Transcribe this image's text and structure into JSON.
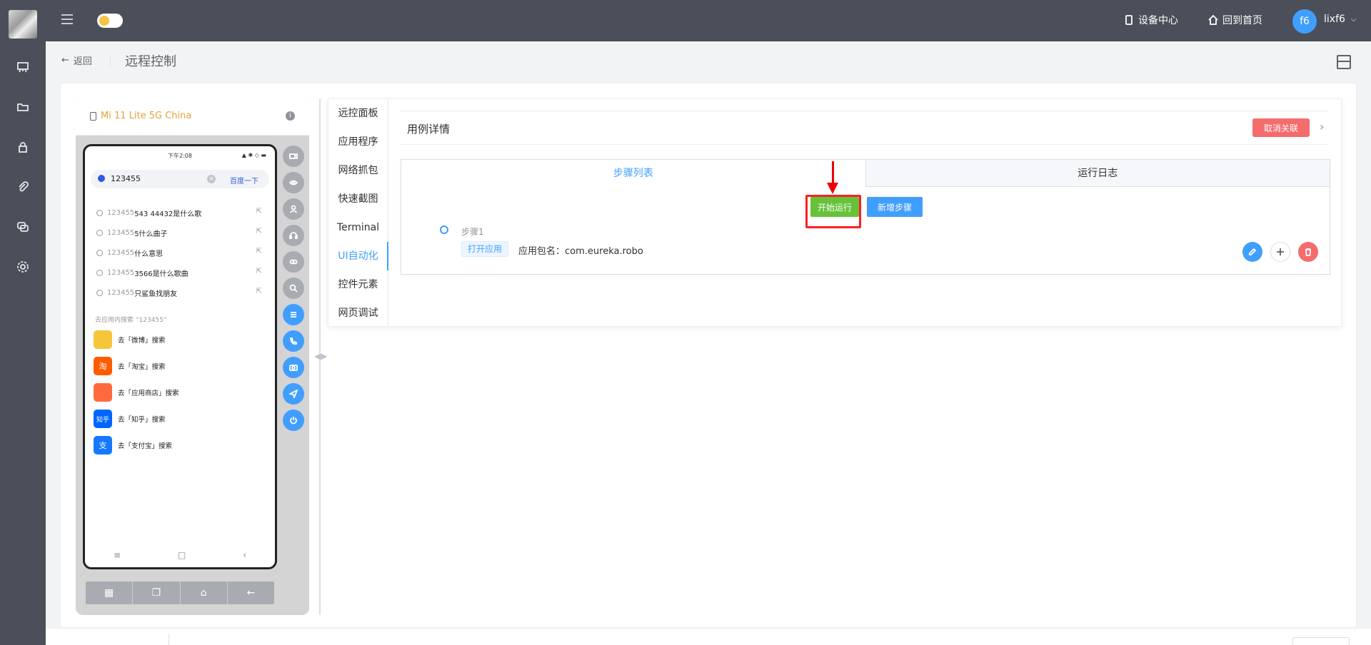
{
  "topbar": {
    "device_center": "设备中心",
    "home": "回到首页",
    "avatar_initials": "f6",
    "username": "lixf6"
  },
  "header": {
    "back": "返回",
    "title": "远程控制"
  },
  "device": {
    "name": "Mi 11 Lite 5G China",
    "status_time": "下午2:08",
    "search_value": "123455",
    "search_button": "百度一下",
    "suggestions": [
      {
        "prefix": "123455",
        "rest": "543 44432是什么歌"
      },
      {
        "prefix": "123455",
        "rest": "5什么曲子"
      },
      {
        "prefix": "123455",
        "rest": "什么意思"
      },
      {
        "prefix": "123455",
        "rest": "3566是什么歌曲"
      },
      {
        "prefix": "123455",
        "rest": "只鲨鱼找朋友"
      }
    ],
    "in_app_hint": "去应用内搜索 “123455”",
    "apps": [
      {
        "label": "去「微博」搜索",
        "icon_text": "",
        "color": "#f7c53a"
      },
      {
        "label": "去「淘宝」搜索",
        "icon_text": "淘",
        "color": "#ff5b00"
      },
      {
        "label": "去「应用商店」搜索",
        "icon_text": "",
        "color": "#ff6a3d"
      },
      {
        "label": "去「知乎」搜索",
        "icon_text": "知乎",
        "color": "#0066ff"
      },
      {
        "label": "去「支付宝」搜索",
        "icon_text": "支",
        "color": "#1677ff"
      }
    ]
  },
  "tabs": {
    "vertical": [
      "远控面板",
      "应用程序",
      "网络抓包",
      "快速截图",
      "Terminal",
      "UI自动化",
      "控件元素",
      "网页调试"
    ],
    "active_vertical": "UI自动化",
    "horizontal": [
      "步骤列表",
      "运行日志"
    ]
  },
  "case": {
    "title": "用例详情",
    "cancel_button": "取消关联",
    "run_button": "开始运行",
    "add_step_button": "新增步骤",
    "step": {
      "name": "步骤1",
      "tag": "打开应用",
      "package": "应用包名：com.eureka.robo"
    }
  },
  "colors": {
    "accent": "#409eff",
    "run_green": "#67c23a",
    "danger": "#f56c6c",
    "highlight_red": "#ff1f1f",
    "device_name_orange": "#e6a23c"
  }
}
